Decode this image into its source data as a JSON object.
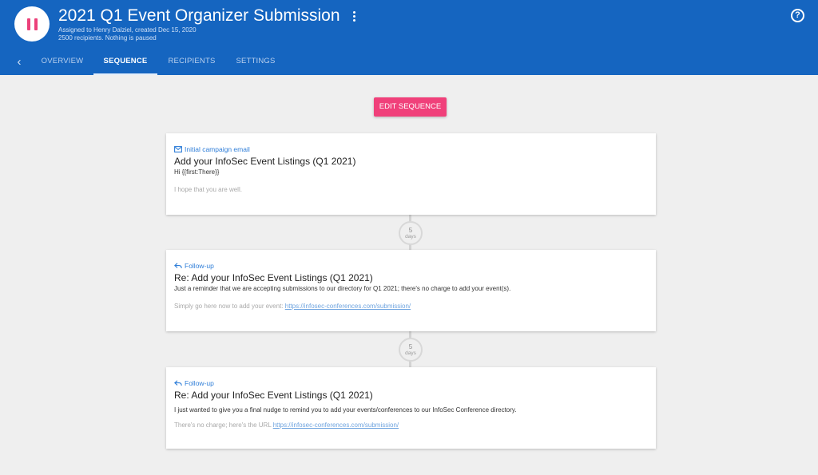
{
  "header": {
    "title": "2021 Q1 Event Organizer Submission",
    "assigned": "Assigned to Henry Dalziel, created Dec 15, 2020",
    "status": "2500 recipients. Nothing is paused",
    "help_symbol": "?",
    "icons": {
      "pause": "pause-icon",
      "more": "kebab-menu-icon",
      "help": "help-circle-icon",
      "back": "chevron-left-icon"
    },
    "colors": {
      "bar": "#1565c0",
      "pause": "#ec407a"
    }
  },
  "tabs": [
    {
      "label": "OVERVIEW",
      "active": false
    },
    {
      "label": "SEQUENCE",
      "active": true
    },
    {
      "label": "RECIPIENTS",
      "active": false
    },
    {
      "label": "SETTINGS",
      "active": false
    }
  ],
  "edit_button": {
    "label": "EDIT SEQUENCE",
    "color": "#f0407a"
  },
  "steps": [
    {
      "type": "Initial campaign email",
      "icon": "envelope-icon",
      "subject": "Add your InfoSec Event Listings (Q1 2021)",
      "line1": "Hi {{first:There}}",
      "line2": "I hope that you are well.",
      "link": ""
    },
    {
      "type": "Follow-up",
      "icon": "reply-icon",
      "subject": "Re: Add your InfoSec Event Listings (Q1 2021)",
      "line1": "Just a reminder that we are accepting submissions to our directory for Q1 2021; there's no charge to add your event(s).",
      "line2": "Simply go here now to add your event: ",
      "link": "https://infosec-conferences.com/submission/"
    },
    {
      "type": "Follow-up",
      "icon": "reply-icon",
      "subject": "Re: Add your InfoSec Event Listings (Q1 2021)",
      "line1": "I just wanted to give you a final nudge to remind you to add your events/conferences to our InfoSec Conference directory.",
      "line2": "There's no charge; here's the URL ",
      "link": "https://infosec-conferences.com/submission/"
    }
  ],
  "delays": [
    {
      "value": "5",
      "unit": "days"
    },
    {
      "value": "5",
      "unit": "days"
    }
  ]
}
